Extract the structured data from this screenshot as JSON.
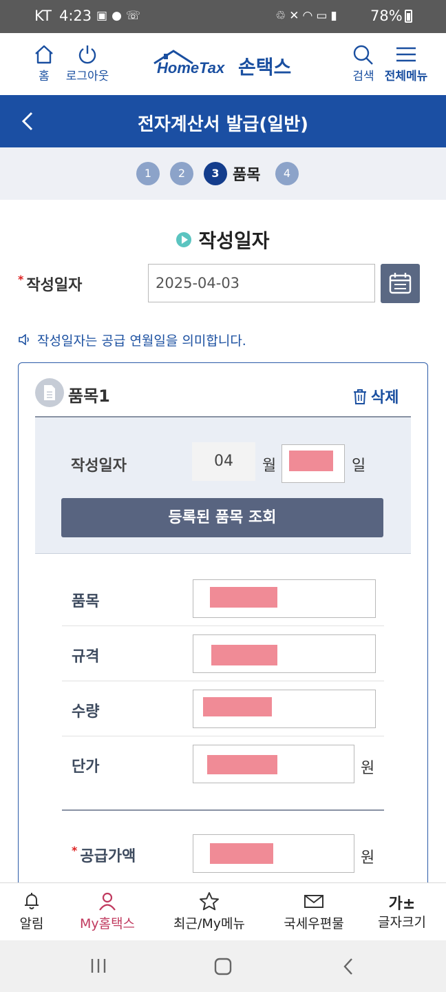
{
  "status_bar": {
    "carrier": "KT",
    "time": "4:23",
    "battery": "78%",
    "left_icons": [
      "image-icon",
      "chat-icon",
      "call-icon"
    ],
    "right_icons": [
      "recycle-icon",
      "mute-icon",
      "wifi-icon",
      "hd-icon",
      "signal-icon"
    ]
  },
  "header": {
    "home_label": "홈",
    "logout_label": "로그아웃",
    "logo_en": "HomeTax",
    "logo_ko": "손택스",
    "search_label": "검색",
    "menu_label": "전체메뉴"
  },
  "titlebar": {
    "title": "전자계산서 발급(일반)"
  },
  "steps": {
    "items": [
      "1",
      "2",
      "3",
      "4"
    ],
    "active_index": 2,
    "active_label": "품목"
  },
  "section": {
    "title": "작성일자",
    "date_label": "작성일자",
    "date_value": "2025-04-03",
    "notice": "작성일자는 공급 연월일을 의미합니다."
  },
  "item_card": {
    "title": "품목1",
    "delete_label": "삭제",
    "write_date_label": "작성일자",
    "month_value": "04",
    "month_unit": "월",
    "day_unit": "일",
    "query_button": "등록된 품목 조회",
    "fields": {
      "item_label": "품목",
      "spec_label": "규격",
      "qty_label": "수량",
      "price_label": "단가",
      "price_unit": "원",
      "supply_label": "공급가액",
      "supply_unit": "원"
    }
  },
  "bottom_nav": {
    "items": [
      {
        "label": "알림",
        "icon": "bell-icon"
      },
      {
        "label": "My홈택스",
        "icon": "person-icon"
      },
      {
        "label": "최근/My메뉴",
        "icon": "star-icon"
      },
      {
        "label": "국세우편물",
        "icon": "mail-icon"
      },
      {
        "label": "글자크기",
        "icon": "가±"
      }
    ],
    "active_index": 1
  },
  "colors": {
    "brand_blue": "#1b4fa3",
    "active_nav": "#c0395e",
    "redaction": "#f08b96"
  }
}
